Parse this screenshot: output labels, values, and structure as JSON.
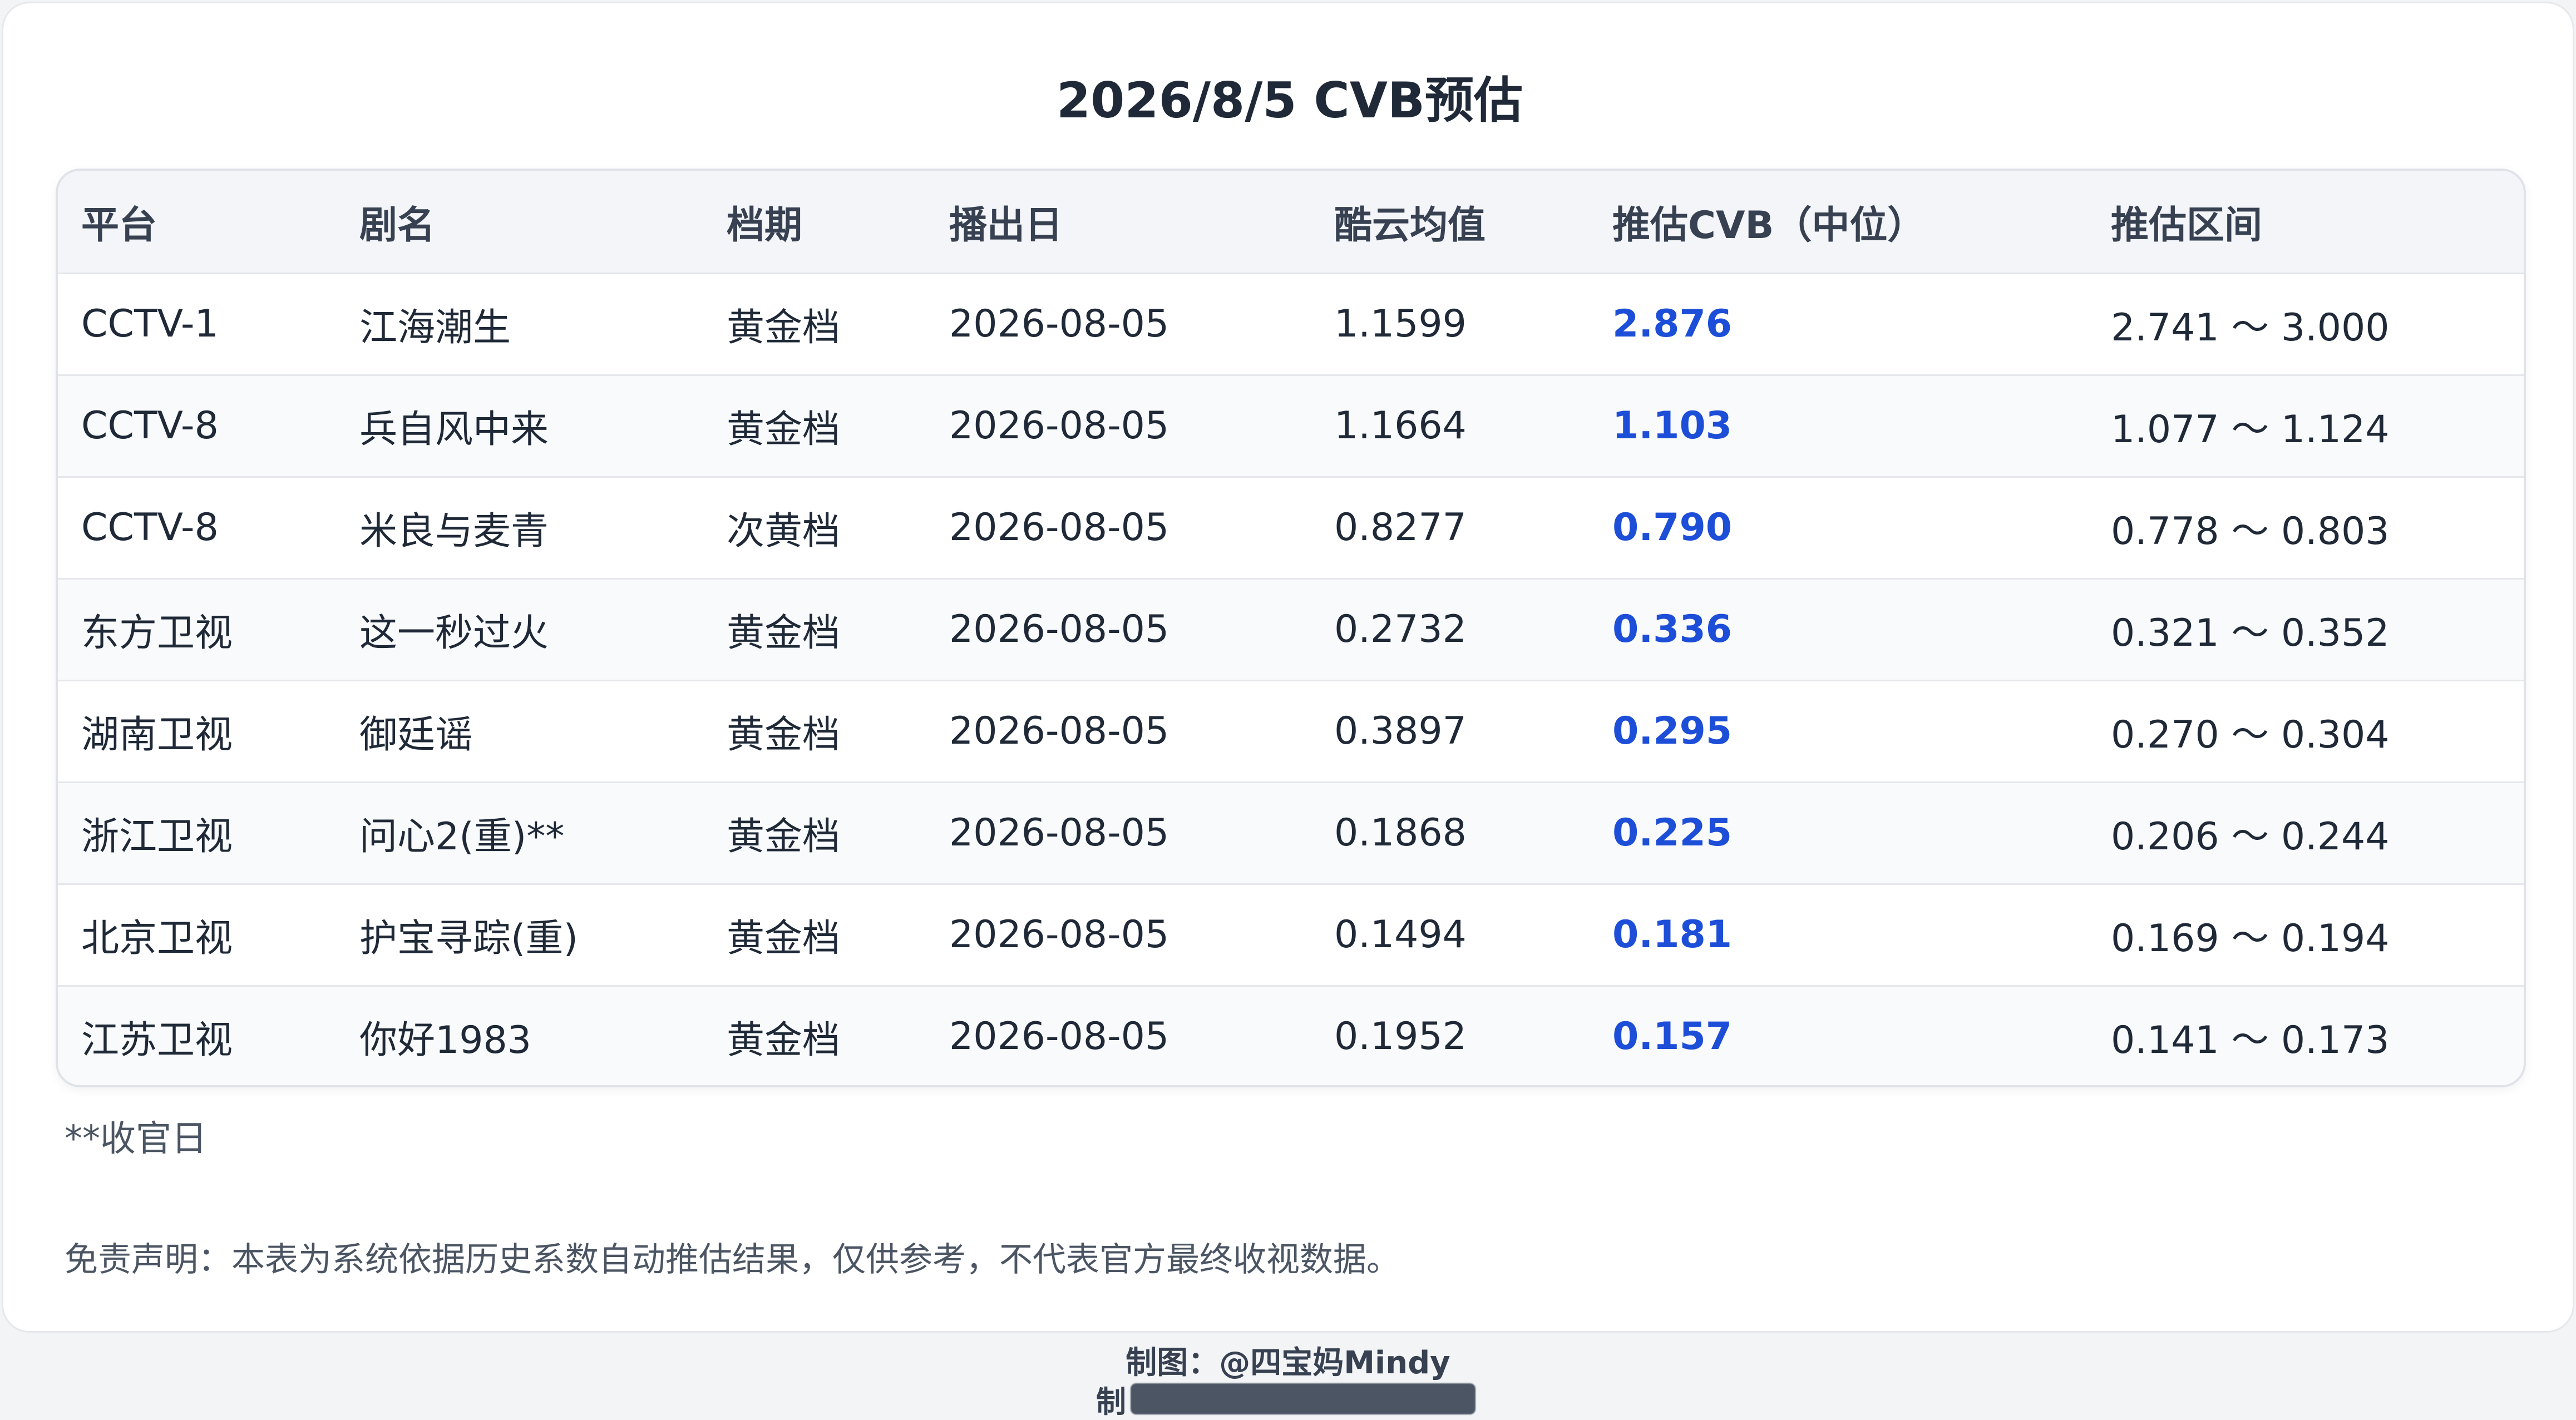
{
  "title": "2026/8/5 CVB预估",
  "table": {
    "headers": [
      "平台",
      "剧名",
      "档期",
      "播出日",
      "酷云均值",
      "推估CVB（中位）",
      "推估区间"
    ],
    "rows": [
      {
        "platform": "CCTV-1",
        "drama": "江海潮生",
        "slot": "黄金档",
        "date": "2026-08-05",
        "kuyun": "1.1599",
        "cvb": "2.876",
        "range": "2.741 ～ 3.000"
      },
      {
        "platform": "CCTV-8",
        "drama": "兵自风中来",
        "slot": "黄金档",
        "date": "2026-08-05",
        "kuyun": "1.1664",
        "cvb": "1.103",
        "range": "1.077 ～ 1.124"
      },
      {
        "platform": "CCTV-8",
        "drama": "米良与麦青",
        "slot": "次黄档",
        "date": "2026-08-05",
        "kuyun": "0.8277",
        "cvb": "0.790",
        "range": "0.778 ～ 0.803"
      },
      {
        "platform": "东方卫视",
        "drama": "这一秒过火",
        "slot": "黄金档",
        "date": "2026-08-05",
        "kuyun": "0.2732",
        "cvb": "0.336",
        "range": "0.321 ～ 0.352"
      },
      {
        "platform": "湖南卫视",
        "drama": "御廷谣",
        "slot": "黄金档",
        "date": "2026-08-05",
        "kuyun": "0.3897",
        "cvb": "0.295",
        "range": "0.270 ～ 0.304"
      },
      {
        "platform": "浙江卫视",
        "drama": "问心2(重)**",
        "slot": "黄金档",
        "date": "2026-08-05",
        "kuyun": "0.1868",
        "cvb": "0.225",
        "range": "0.206 ～ 0.244"
      },
      {
        "platform": "北京卫视",
        "drama": "护宝寻踪(重)",
        "slot": "黄金档",
        "date": "2026-08-05",
        "kuyun": "0.1494",
        "cvb": "0.181",
        "range": "0.169 ～ 0.194"
      },
      {
        "platform": "江苏卫视",
        "drama": "你好1983",
        "slot": "黄金档",
        "date": "2026-08-05",
        "kuyun": "0.1952",
        "cvb": "0.157",
        "range": "0.141 ～ 0.173"
      }
    ]
  },
  "footnote": "**收官日",
  "disclaimer": "免责声明：本表为系统依据历史系数自动推估结果，仅供参考，不代表官方最终收视数据。",
  "credit": "制图：@四宝妈Mindy",
  "credit2_prefix": "制",
  "colors": {
    "cvb_highlight": "#1d4ed8",
    "header_bg": "#f3f5f8"
  }
}
